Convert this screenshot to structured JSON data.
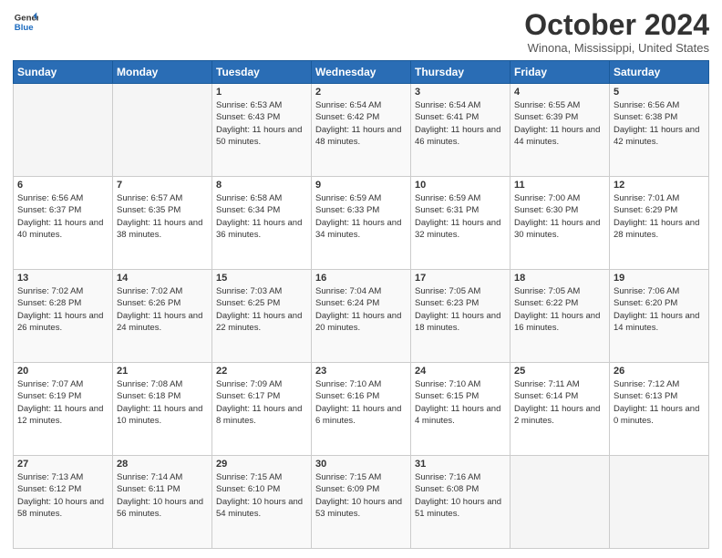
{
  "header": {
    "logo_general": "General",
    "logo_blue": "Blue",
    "title": "October 2024",
    "location": "Winona, Mississippi, United States"
  },
  "weekdays": [
    "Sunday",
    "Monday",
    "Tuesday",
    "Wednesday",
    "Thursday",
    "Friday",
    "Saturday"
  ],
  "weeks": [
    [
      {
        "day": "",
        "info": ""
      },
      {
        "day": "",
        "info": ""
      },
      {
        "day": "1",
        "info": "Sunrise: 6:53 AM\nSunset: 6:43 PM\nDaylight: 11 hours and 50 minutes."
      },
      {
        "day": "2",
        "info": "Sunrise: 6:54 AM\nSunset: 6:42 PM\nDaylight: 11 hours and 48 minutes."
      },
      {
        "day": "3",
        "info": "Sunrise: 6:54 AM\nSunset: 6:41 PM\nDaylight: 11 hours and 46 minutes."
      },
      {
        "day": "4",
        "info": "Sunrise: 6:55 AM\nSunset: 6:39 PM\nDaylight: 11 hours and 44 minutes."
      },
      {
        "day": "5",
        "info": "Sunrise: 6:56 AM\nSunset: 6:38 PM\nDaylight: 11 hours and 42 minutes."
      }
    ],
    [
      {
        "day": "6",
        "info": "Sunrise: 6:56 AM\nSunset: 6:37 PM\nDaylight: 11 hours and 40 minutes."
      },
      {
        "day": "7",
        "info": "Sunrise: 6:57 AM\nSunset: 6:35 PM\nDaylight: 11 hours and 38 minutes."
      },
      {
        "day": "8",
        "info": "Sunrise: 6:58 AM\nSunset: 6:34 PM\nDaylight: 11 hours and 36 minutes."
      },
      {
        "day": "9",
        "info": "Sunrise: 6:59 AM\nSunset: 6:33 PM\nDaylight: 11 hours and 34 minutes."
      },
      {
        "day": "10",
        "info": "Sunrise: 6:59 AM\nSunset: 6:31 PM\nDaylight: 11 hours and 32 minutes."
      },
      {
        "day": "11",
        "info": "Sunrise: 7:00 AM\nSunset: 6:30 PM\nDaylight: 11 hours and 30 minutes."
      },
      {
        "day": "12",
        "info": "Sunrise: 7:01 AM\nSunset: 6:29 PM\nDaylight: 11 hours and 28 minutes."
      }
    ],
    [
      {
        "day": "13",
        "info": "Sunrise: 7:02 AM\nSunset: 6:28 PM\nDaylight: 11 hours and 26 minutes."
      },
      {
        "day": "14",
        "info": "Sunrise: 7:02 AM\nSunset: 6:26 PM\nDaylight: 11 hours and 24 minutes."
      },
      {
        "day": "15",
        "info": "Sunrise: 7:03 AM\nSunset: 6:25 PM\nDaylight: 11 hours and 22 minutes."
      },
      {
        "day": "16",
        "info": "Sunrise: 7:04 AM\nSunset: 6:24 PM\nDaylight: 11 hours and 20 minutes."
      },
      {
        "day": "17",
        "info": "Sunrise: 7:05 AM\nSunset: 6:23 PM\nDaylight: 11 hours and 18 minutes."
      },
      {
        "day": "18",
        "info": "Sunrise: 7:05 AM\nSunset: 6:22 PM\nDaylight: 11 hours and 16 minutes."
      },
      {
        "day": "19",
        "info": "Sunrise: 7:06 AM\nSunset: 6:20 PM\nDaylight: 11 hours and 14 minutes."
      }
    ],
    [
      {
        "day": "20",
        "info": "Sunrise: 7:07 AM\nSunset: 6:19 PM\nDaylight: 11 hours and 12 minutes."
      },
      {
        "day": "21",
        "info": "Sunrise: 7:08 AM\nSunset: 6:18 PM\nDaylight: 11 hours and 10 minutes."
      },
      {
        "day": "22",
        "info": "Sunrise: 7:09 AM\nSunset: 6:17 PM\nDaylight: 11 hours and 8 minutes."
      },
      {
        "day": "23",
        "info": "Sunrise: 7:10 AM\nSunset: 6:16 PM\nDaylight: 11 hours and 6 minutes."
      },
      {
        "day": "24",
        "info": "Sunrise: 7:10 AM\nSunset: 6:15 PM\nDaylight: 11 hours and 4 minutes."
      },
      {
        "day": "25",
        "info": "Sunrise: 7:11 AM\nSunset: 6:14 PM\nDaylight: 11 hours and 2 minutes."
      },
      {
        "day": "26",
        "info": "Sunrise: 7:12 AM\nSunset: 6:13 PM\nDaylight: 11 hours and 0 minutes."
      }
    ],
    [
      {
        "day": "27",
        "info": "Sunrise: 7:13 AM\nSunset: 6:12 PM\nDaylight: 10 hours and 58 minutes."
      },
      {
        "day": "28",
        "info": "Sunrise: 7:14 AM\nSunset: 6:11 PM\nDaylight: 10 hours and 56 minutes."
      },
      {
        "day": "29",
        "info": "Sunrise: 7:15 AM\nSunset: 6:10 PM\nDaylight: 10 hours and 54 minutes."
      },
      {
        "day": "30",
        "info": "Sunrise: 7:15 AM\nSunset: 6:09 PM\nDaylight: 10 hours and 53 minutes."
      },
      {
        "day": "31",
        "info": "Sunrise: 7:16 AM\nSunset: 6:08 PM\nDaylight: 10 hours and 51 minutes."
      },
      {
        "day": "",
        "info": ""
      },
      {
        "day": "",
        "info": ""
      }
    ]
  ]
}
